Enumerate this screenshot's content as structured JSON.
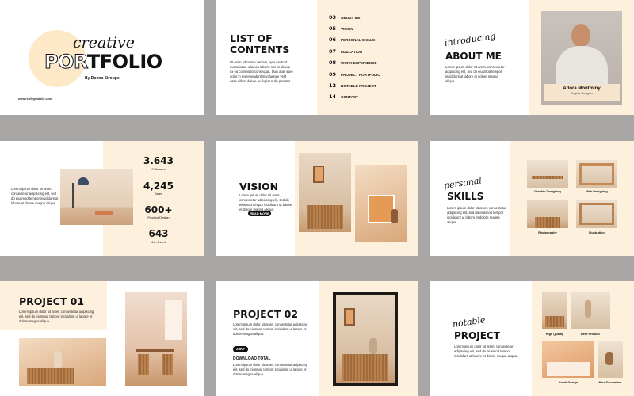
{
  "cover": {
    "script_title": "creative",
    "title_a": "POR",
    "title_b": "TFOLIO",
    "author": "By Donna Stroupe",
    "website": "www.reallygreatsite.com"
  },
  "contents": {
    "title_line1": "LIST OF",
    "title_line2": "CONTENTS",
    "body": "Ut enim ad minim veniam, quis nostrud exercitation ullamco laboris nisi ut aliquip ex ea commodo consequat. Duis aute irure dolor in reprehenderit in voluptate velit esse cillum dolore eu fugiat nulla pariatur.",
    "items": [
      {
        "num": "03",
        "label": "ABOUT ME"
      },
      {
        "num": "05",
        "label": "VISION"
      },
      {
        "num": "06",
        "label": "PERSONAL SKILLS"
      },
      {
        "num": "07",
        "label": "EDUCATION"
      },
      {
        "num": "08",
        "label": "WORK EXPERIENCE"
      },
      {
        "num": "09",
        "label": "PROJECT PORTFOLIO"
      },
      {
        "num": "12",
        "label": "NOTABLE PROJECT"
      },
      {
        "num": "14",
        "label": "CONTACT"
      }
    ]
  },
  "about": {
    "script_title": "introducing",
    "title": "ABOUT ME",
    "body": "Lorem ipsum dolor sit amet, consectetur adipiscing elit, sed do eiusmod tempor incididunt ut labore et dolore magna aliqua.",
    "name": "Adora Montminy",
    "role": "Graphic Designer"
  },
  "stats": {
    "body": "Lorem ipsum dolor sit amet, consectetur adipiscing elit, sed do eiusmod tempor incididunt ut labore et dolore magna aliqua.",
    "items": [
      {
        "value": "3.643",
        "label": "Followers"
      },
      {
        "value": "4,245",
        "label": "Sales"
      },
      {
        "value": "600+",
        "label": "Product Design"
      },
      {
        "value": "643",
        "label": "Job Event"
      }
    ]
  },
  "vision": {
    "title": "VISION",
    "body": "Lorem ipsum dolor sit amet, consectetur adipiscing elit, sed do eiusmod tempor incididunt ut labore et dolore magna aliqua.",
    "button": "READ MORE"
  },
  "skills": {
    "script_title": "personal",
    "title": "SKILLS",
    "body": "Lorem ipsum dolor sit amet, consectetur adipiscing elit, sed do eiusmod tempor incididunt ut labore et dolore magna aliqua.",
    "captions": [
      "Graphic Designing",
      "Web Designing",
      "Photography",
      "Illustration"
    ]
  },
  "project01": {
    "title": "PROJECT 01",
    "body": "Lorem ipsum dolor sit amet, consectetur adipiscing elit, sed do eiusmod tempor incididunt ut labore et dolore magna aliqua."
  },
  "project02": {
    "title": "PROJECT 02",
    "body": "Lorem ipsum dolor sit amet, consectetur adipiscing elit, sed do eiusmod tempor incididunt ut labore et dolore magna aliqua.",
    "badge": "25K+",
    "download_label": "DOWNLOAD TOTAL",
    "body2": "Lorem ipsum dolor sit amet, consectetur adipiscing elit, sed do eiusmod tempor incididunt ut labore et dolore magna aliqua."
  },
  "notable": {
    "script_title": "notable",
    "title": "PROJECT",
    "body": "Lorem ipsum dolor sit amet, consectetur adipiscing elit, sed do eiusmod tempor incididunt ut labore et dolore magna aliqua.",
    "captions": [
      "High Quality",
      "Best Product",
      "Creek Design",
      "Nice Decoration"
    ]
  },
  "colors": {
    "background": "#a9a7a5",
    "cream": "#fdf1de",
    "ink": "#111111"
  }
}
